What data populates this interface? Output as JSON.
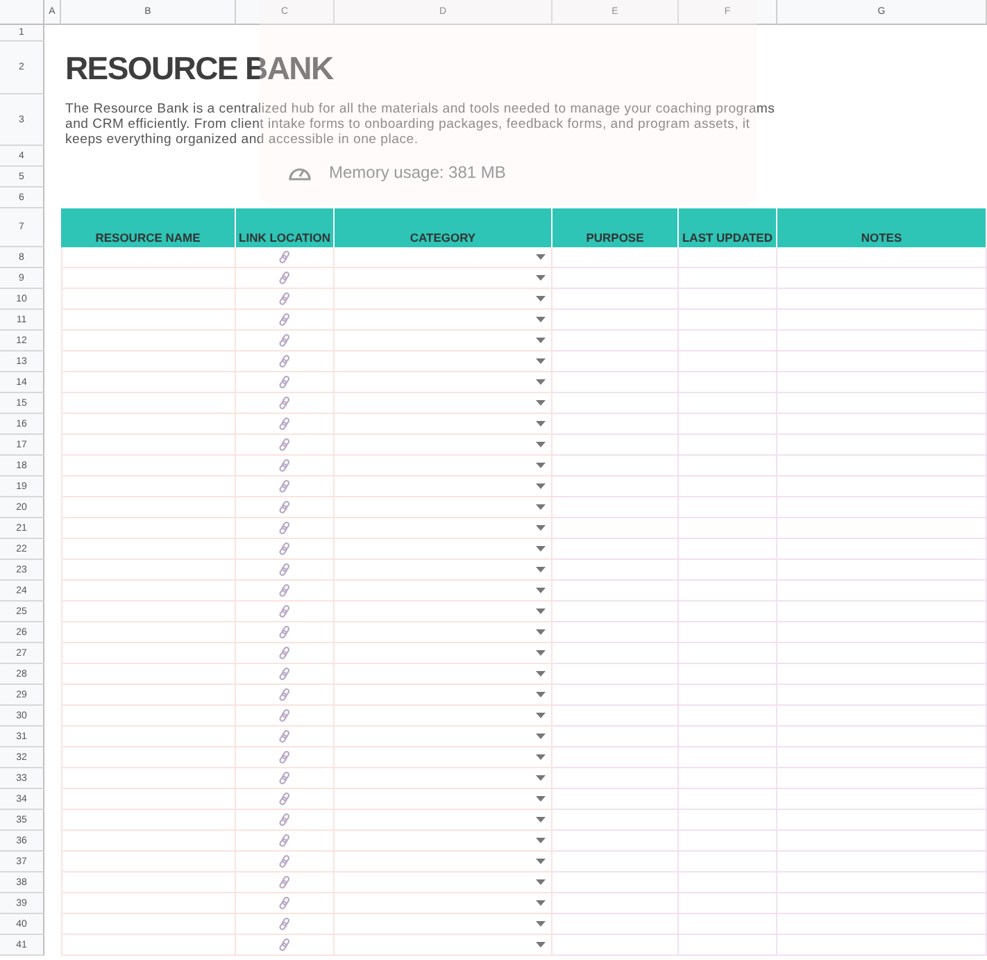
{
  "column_letters": [
    "A",
    "B",
    "C",
    "D",
    "E",
    "F",
    "G"
  ],
  "title": "RESOURCE BANK",
  "description": "The Resource Bank is a centralized hub for all the materials and tools needed to manage your coaching programs and CRM efficiently. From client intake forms to onboarding packages, feedback forms, and program assets, it keeps everything organized and accessible in one place.",
  "top_rows": [
    "1",
    "2",
    "3",
    "4",
    "5",
    "6",
    "7"
  ],
  "table": {
    "columns": [
      "RESOURCE NAME",
      "LINK LOCATION",
      "CATEGORY",
      "PURPOSE",
      "LAST UPDATED",
      "NOTES"
    ],
    "rows": [
      {
        "row": "8"
      },
      {
        "row": "9"
      },
      {
        "row": "10"
      },
      {
        "row": "11"
      },
      {
        "row": "12"
      },
      {
        "row": "13"
      },
      {
        "row": "14"
      },
      {
        "row": "15"
      },
      {
        "row": "16"
      },
      {
        "row": "17"
      },
      {
        "row": "18"
      },
      {
        "row": "19"
      },
      {
        "row": "20"
      },
      {
        "row": "21"
      },
      {
        "row": "22"
      },
      {
        "row": "23"
      },
      {
        "row": "24"
      },
      {
        "row": "25"
      },
      {
        "row": "26"
      },
      {
        "row": "27"
      },
      {
        "row": "28"
      },
      {
        "row": "29"
      },
      {
        "row": "30"
      },
      {
        "row": "31"
      },
      {
        "row": "32"
      },
      {
        "row": "33"
      },
      {
        "row": "34"
      },
      {
        "row": "35"
      },
      {
        "row": "36"
      },
      {
        "row": "37"
      },
      {
        "row": "38"
      },
      {
        "row": "39"
      },
      {
        "row": "40"
      },
      {
        "row": "41"
      }
    ]
  },
  "toast": {
    "text": "Memory usage: 381 MB"
  }
}
